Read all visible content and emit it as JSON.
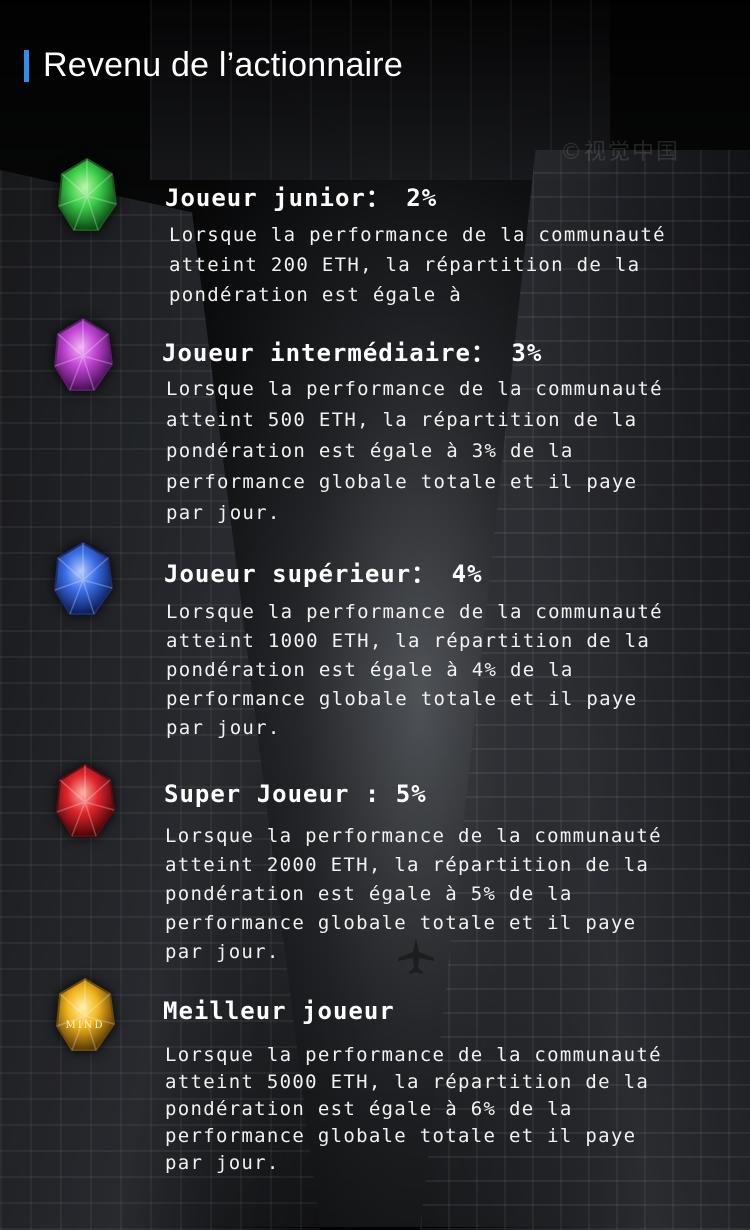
{
  "header": {
    "title": "Revenu de l’actionnaire"
  },
  "watermark": "©视觉中国",
  "colors": {
    "accent": "#2f8fe8"
  },
  "tiers": [
    {
      "title": "Joueur junior： 2%",
      "description": "Lorsque la performance de la communauté\natteint 200 ETH, la répartition de la\npondération est égale à",
      "gem": "green-gem-icon",
      "gem_color": "#3ccf4a"
    },
    {
      "title": "Joueur intermédiaire： 3%",
      "description": "Lorsque la performance de la communauté\natteint 500 ETH, la répartition de la\npondération est égale à 3% de la\nperformance globale totale et il paye\npar jour.",
      "gem": "purple-gem-icon",
      "gem_color": "#c146d4"
    },
    {
      "title": "Joueur supérieur： 4%",
      "description": "Lorsque la performance de la communauté\natteint 1000 ETH, la répartition de la\npondération est égale à 4% de la\nperformance globale totale et il paye\npar jour.",
      "gem": "blue-gem-icon",
      "gem_color": "#3b6ee6"
    },
    {
      "title": "Super Joueur : 5%",
      "description": "Lorsque la performance de la communauté\natteint 2000 ETH, la répartition de la\npondération est égale à 5% de la\nperformance globale totale et il paye\npar jour.",
      "gem": "red-gem-icon",
      "gem_color": "#e0262c"
    },
    {
      "title": "Meilleur joueur",
      "description": "Lorsque la performance de la communauté\natteint 5000 ETH, la répartition de la\npondération est égale à 6% de la\nperformance globale totale et il paye\npar jour.",
      "gem": "yellow-gem-icon",
      "gem_color": "#f2b51c",
      "gem_text": "MIND"
    }
  ]
}
